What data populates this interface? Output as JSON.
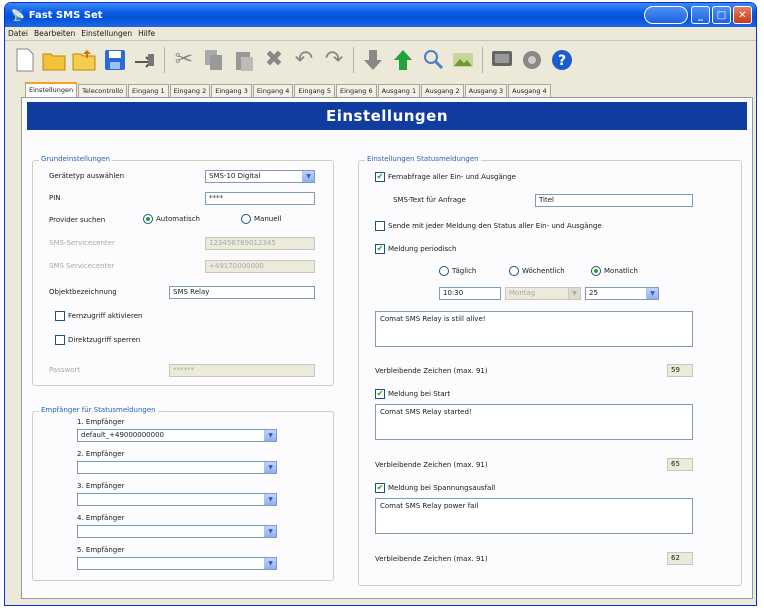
{
  "title": "Fast SMS Set",
  "title_icon": "antenna-icon",
  "menu": [
    "Datei",
    "Bearbeiten",
    "Einstellungen",
    "Hilfe"
  ],
  "toolbar_icons": [
    "new-file-icon",
    "open-folder-icon",
    "open-folder-alt-icon",
    "save-icon",
    "send-icon",
    "cut-icon",
    "copy-icon",
    "paste-icon",
    "delete-icon",
    "undo-icon",
    "redo-icon",
    "download-icon",
    "upload-icon",
    "search-icon",
    "image-icon",
    "monitor-icon",
    "gear-icon",
    "help-icon"
  ],
  "tabs": [
    "Einstellungen",
    "Telecontrollo",
    "Eingang 1",
    "Eingang 2",
    "Eingang 3",
    "Eingang 4",
    "Eingang 5",
    "Eingang 6",
    "Ausgang 1",
    "Ausgang 2",
    "Ausgang 3",
    "Ausgang 4"
  ],
  "banner": "Einstellungen",
  "grund": {
    "title": "Grundeinstellungen",
    "geraet_label": "Gerätetyp auswählen",
    "geraet_value": "SMS-10 Digital",
    "pin_label": "PIN",
    "pin_value": "****",
    "provider_label": "Provider suchen",
    "provider_auto": "Automatisch",
    "provider_manual": "Manuell",
    "sms_center_label": "SMS-Servicecenter",
    "sms_center_value": "123456789012345",
    "service_label": "SMS Servicecenter",
    "service_value": "+49170000000",
    "objekt_label": "Objektbezeichnung",
    "objekt_value": "SMS Relay",
    "fernzugriff": "Fernzugriff aktivieren",
    "direktzugriff": "Direktzugriff sperren",
    "passwort_label": "Passwort",
    "passwort_value": "******"
  },
  "empf": {
    "title": "Empfänger für Statusmeldungen",
    "items": [
      {
        "label": "1. Empfänger",
        "value": "default_+49000000000"
      },
      {
        "label": "2. Empfänger",
        "value": ""
      },
      {
        "label": "3. Empfänger",
        "value": ""
      },
      {
        "label": "4. Empfänger",
        "value": ""
      },
      {
        "label": "5. Empfänger",
        "value": ""
      }
    ]
  },
  "status": {
    "title": "Einstellungen Statusmeldungen",
    "fernabfrage": "Fernabfrage aller Ein- und Ausgänge",
    "sms_text_label": "SMS-Text für Anfrage",
    "sms_text_value": "Titel",
    "senden": "Sende mit jeder Meldung den Status aller Ein- und Ausgänge",
    "meldung_periodisch": "Meldung periodisch",
    "taeglich": "Täglich",
    "woechentlich": "Wöchentlich",
    "monatlich": "Monatlich",
    "zeit": "10:30",
    "wochentag": "Montag",
    "tag": "25",
    "periodisch_text": "Comat SMS Relay is still alive!",
    "verbleibend_1": "Verbleibende Zeichen (max. 91)",
    "count_1": "59",
    "meldung_start": "Meldung bei Start",
    "start_text": "Comat SMS Relay started!",
    "verbleibend_2": "Verbleibende Zeichen (max. 91)",
    "count_2": "65",
    "meldung_spannung": "Meldung bei Spannungsausfall",
    "spannung_text": "Comat SMS Relay power fail",
    "verbleibend_3": "Verbleibende Zeichen (max. 91)",
    "count_3": "62"
  }
}
